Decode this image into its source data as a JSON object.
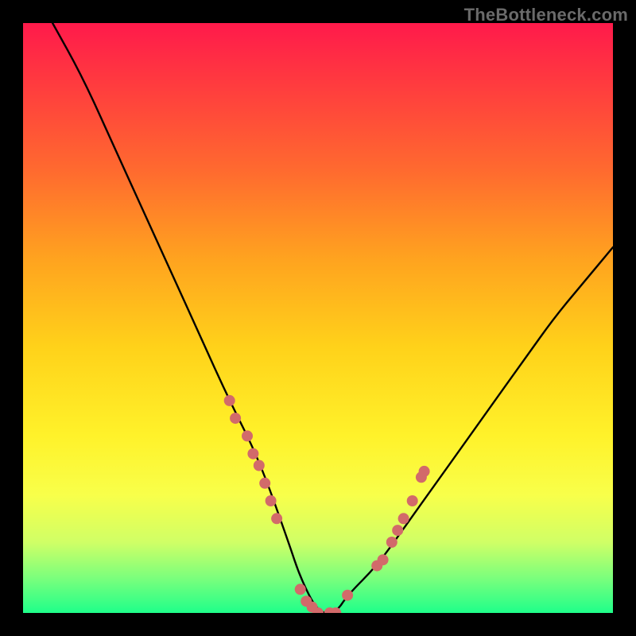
{
  "attribution": "TheBottleneck.com",
  "chart_data": {
    "type": "line",
    "title": "",
    "xlabel": "",
    "ylabel": "",
    "xlim": [
      0,
      100
    ],
    "ylim": [
      0,
      100
    ],
    "grid": false,
    "legend": false,
    "series": [
      {
        "name": "bottleneck-curve",
        "x": [
          5,
          10,
          15,
          20,
          25,
          30,
          35,
          40,
          45,
          47,
          50,
          53,
          55,
          60,
          65,
          70,
          75,
          80,
          85,
          90,
          95,
          100
        ],
        "y": [
          100,
          91,
          80,
          69,
          58,
          47,
          36,
          26,
          12,
          6,
          0,
          0,
          3,
          8,
          15,
          22,
          29,
          36,
          43,
          50,
          56,
          62
        ]
      }
    ],
    "markers": {
      "name": "highlight-dots",
      "color": "#d26a6a",
      "points": [
        {
          "x": 35,
          "y": 36
        },
        {
          "x": 36,
          "y": 33
        },
        {
          "x": 38,
          "y": 30
        },
        {
          "x": 39,
          "y": 27
        },
        {
          "x": 40,
          "y": 25
        },
        {
          "x": 41,
          "y": 22
        },
        {
          "x": 42,
          "y": 19
        },
        {
          "x": 43,
          "y": 16
        },
        {
          "x": 47,
          "y": 4
        },
        {
          "x": 48,
          "y": 2
        },
        {
          "x": 49,
          "y": 1
        },
        {
          "x": 50,
          "y": 0
        },
        {
          "x": 52,
          "y": 0
        },
        {
          "x": 53,
          "y": 0
        },
        {
          "x": 55,
          "y": 3
        },
        {
          "x": 60,
          "y": 8
        },
        {
          "x": 61,
          "y": 9
        },
        {
          "x": 62.5,
          "y": 12
        },
        {
          "x": 63.5,
          "y": 14
        },
        {
          "x": 64.5,
          "y": 16
        },
        {
          "x": 66,
          "y": 19
        },
        {
          "x": 67.5,
          "y": 23
        },
        {
          "x": 68,
          "y": 24
        }
      ]
    },
    "background_gradient": {
      "top": "#ff1a4b",
      "bottom": "#1fff8a"
    }
  }
}
